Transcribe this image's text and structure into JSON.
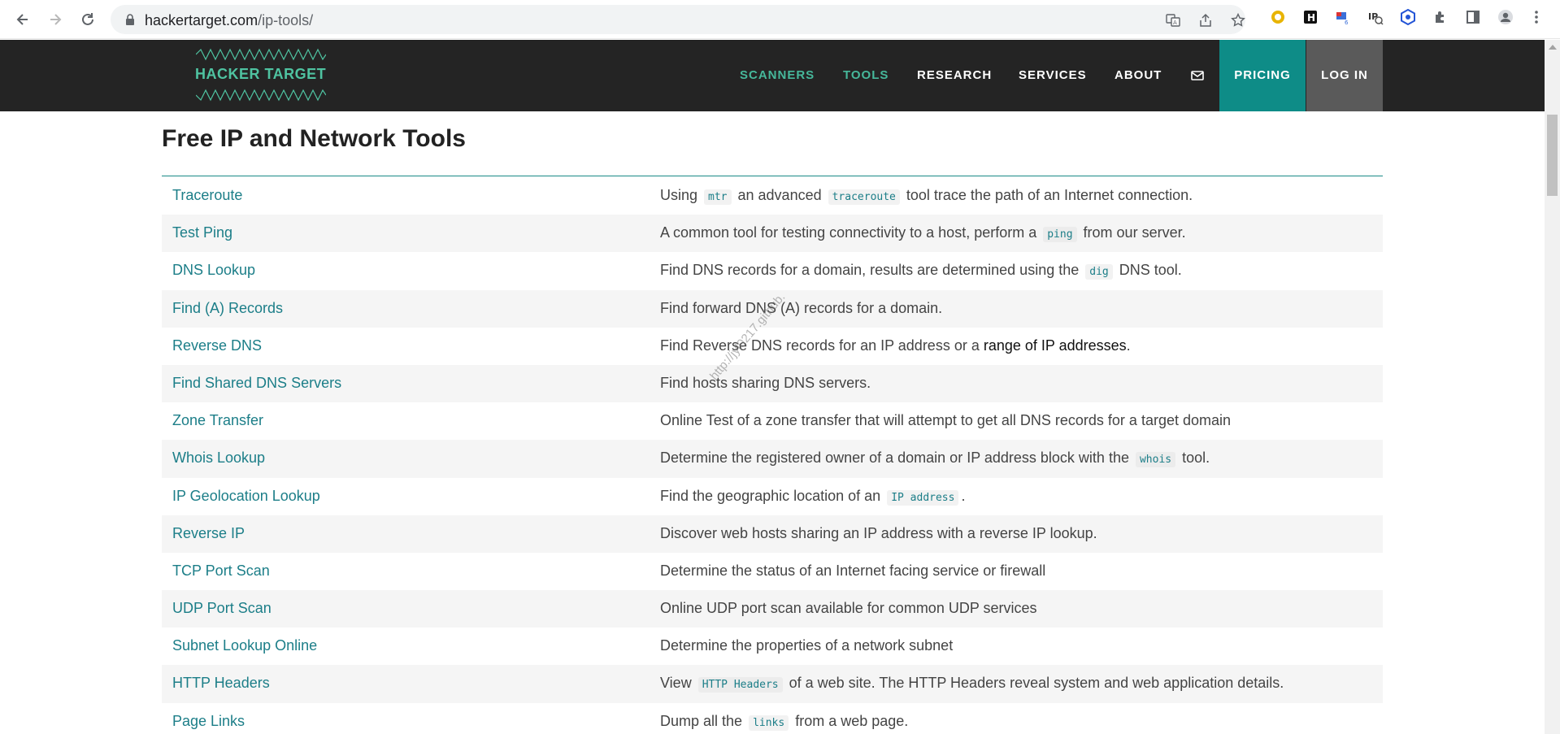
{
  "browser": {
    "url_host": "hackertarget.com",
    "url_path": "/ip-tools/"
  },
  "site": {
    "logo_text": "HACKER TARGET",
    "nav": {
      "scanners": "SCANNERS",
      "tools": "TOOLS",
      "research": "RESEARCH",
      "services": "SERVICES",
      "about": "ABOUT",
      "pricing": "PRICING",
      "login": "LOG IN"
    }
  },
  "page": {
    "title": "Free IP and Network Tools"
  },
  "tools": [
    {
      "name": "Traceroute",
      "desc": [
        {
          "t": "Using "
        },
        {
          "c": "mtr"
        },
        {
          "t": " an advanced "
        },
        {
          "c": "traceroute"
        },
        {
          "t": " tool trace the path of an Internet connection."
        }
      ]
    },
    {
      "name": "Test Ping",
      "desc": [
        {
          "t": "A common tool for testing connectivity to a host, perform a "
        },
        {
          "c": "ping"
        },
        {
          "t": " from our server."
        }
      ]
    },
    {
      "name": "DNS Lookup",
      "desc": [
        {
          "t": "Find DNS records for a domain, results are determined using the "
        },
        {
          "c": "dig"
        },
        {
          "t": " DNS tool."
        }
      ]
    },
    {
      "name": "Find (A) Records",
      "desc": [
        {
          "t": "Find forward DNS (A) records for a domain."
        }
      ]
    },
    {
      "name": "Reverse DNS",
      "desc": [
        {
          "t": "Find Reverse DNS records for an IP address or a "
        },
        {
          "b": "range of IP addresses"
        },
        {
          "t": "."
        }
      ]
    },
    {
      "name": "Find Shared DNS Servers",
      "desc": [
        {
          "t": "Find hosts sharing DNS servers."
        }
      ]
    },
    {
      "name": "Zone Transfer",
      "desc": [
        {
          "t": "Online Test of a zone transfer that will attempt to get all DNS records for a target domain"
        }
      ]
    },
    {
      "name": "Whois Lookup",
      "desc": [
        {
          "t": "Determine the registered owner of a domain or IP address block with the "
        },
        {
          "c": "whois"
        },
        {
          "t": " tool."
        }
      ]
    },
    {
      "name": "IP Geolocation Lookup",
      "desc": [
        {
          "t": "Find the geographic location of an "
        },
        {
          "c": "IP address"
        },
        {
          "t": "."
        }
      ]
    },
    {
      "name": "Reverse IP",
      "desc": [
        {
          "t": "Discover web hosts sharing an IP address with a reverse IP lookup."
        }
      ]
    },
    {
      "name": "TCP Port Scan",
      "desc": [
        {
          "t": "Determine the status of an Internet facing service or firewall"
        }
      ]
    },
    {
      "name": "UDP Port Scan",
      "desc": [
        {
          "t": "Online UDP port scan available for common UDP services"
        }
      ]
    },
    {
      "name": "Subnet Lookup Online",
      "desc": [
        {
          "t": "Determine the properties of a network subnet"
        }
      ]
    },
    {
      "name": "HTTP Headers",
      "desc": [
        {
          "t": "View "
        },
        {
          "c": "HTTP Headers"
        },
        {
          "t": " of a web site. The HTTP Headers reveal system and web application details."
        }
      ]
    },
    {
      "name": "Page Links",
      "desc": [
        {
          "t": "Dump all the "
        },
        {
          "c": "links"
        },
        {
          "t": " from a web page."
        }
      ]
    }
  ],
  "watermark": "http://jyl0217.github.",
  "colors": {
    "link": "#1c7e88",
    "nav_green": "#46b89b",
    "pricing_bg": "#0e8c87",
    "login_bg": "#5a5a5a",
    "header_bg": "#242424"
  }
}
